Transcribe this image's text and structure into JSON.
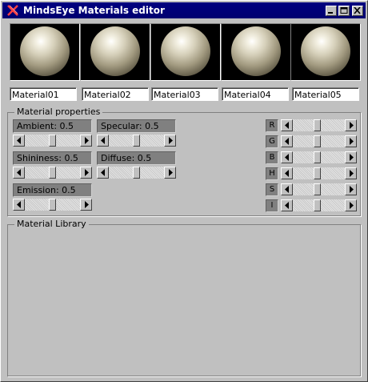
{
  "window": {
    "title": "MindsEye Materials editor",
    "title_icon": "x-app-icon"
  },
  "title_buttons": [
    "minimize-icon",
    "maximize-icon",
    "close-icon"
  ],
  "materials": [
    {
      "name": "Material01"
    },
    {
      "name": "Material02"
    },
    {
      "name": "Material03"
    },
    {
      "name": "Material04"
    },
    {
      "name": "Material05"
    }
  ],
  "properties_group": {
    "label": "Material properties",
    "ambient": {
      "label": "Ambient: 0.5",
      "value": 0.5
    },
    "specular": {
      "label": "Specular: 0.5",
      "value": 0.5
    },
    "shininess": {
      "label": "Shininess: 0.5",
      "value": 0.5
    },
    "diffuse": {
      "label": "Diffuse: 0.5",
      "value": 0.5
    },
    "emission": {
      "label": "Emission: 0.5",
      "value": 0.5
    }
  },
  "channels": [
    {
      "label": "R",
      "value": 0.5
    },
    {
      "label": "G",
      "value": 0.5
    },
    {
      "label": "B",
      "value": 0.5
    },
    {
      "label": "H",
      "value": 0.5
    },
    {
      "label": "S",
      "value": 0.5
    },
    {
      "label": "I",
      "value": 0.5
    }
  ],
  "library_group": {
    "label": "Material Library"
  },
  "colors": {
    "titlebar": "#000080",
    "panel": "#c0c0c0",
    "label_bg": "#808080",
    "sphere_highlight": "#f4f1e4"
  }
}
